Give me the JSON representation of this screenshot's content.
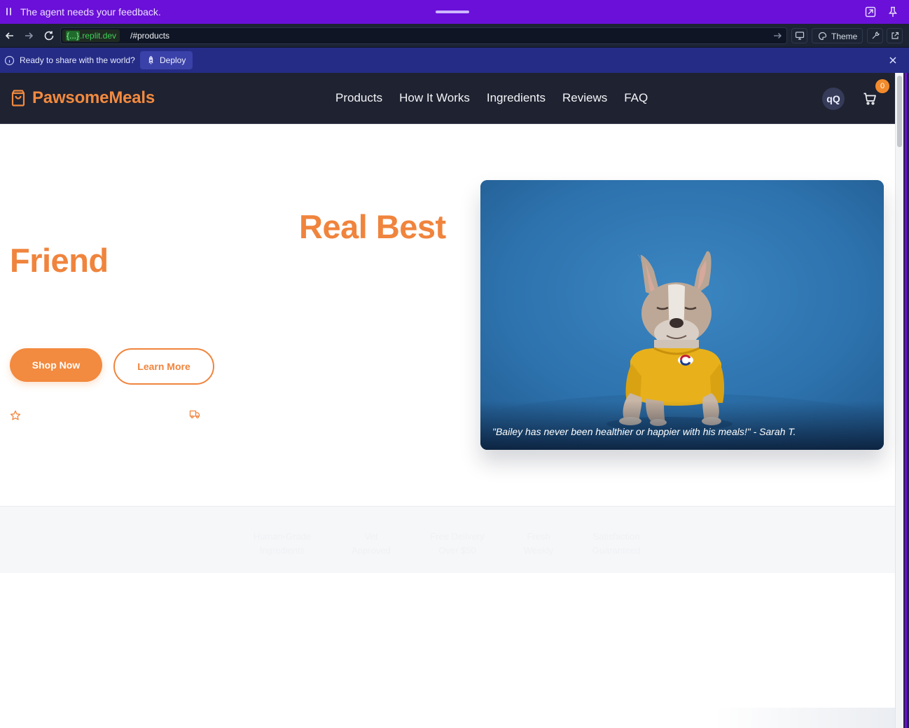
{
  "agent_bar": {
    "message": "The agent needs your feedback."
  },
  "url_bar": {
    "host_braces": "{...}",
    "host_domain": ".replit.dev",
    "path": "/#products",
    "theme_label": "Theme"
  },
  "deploy_bar": {
    "prompt": "Ready to share with the world?",
    "deploy_label": "Deploy"
  },
  "site": {
    "brand": "PawsomeMeals",
    "nav": [
      "Products",
      "How It Works",
      "Ingredients",
      "Reviews",
      "FAQ"
    ],
    "avatar_initials": "qQ",
    "cart_count": "0"
  },
  "hero": {
    "headline_line1": "Real Best",
    "headline_line2": "Friend",
    "shop_label": "Shop Now",
    "learn_label": "Learn More",
    "testimonial": "\"Bailey has never been healthier or happier with his meals!\" - Sarah T."
  },
  "features": [
    [
      "Human-Grade",
      "Ingredients"
    ],
    [
      "Vet",
      "Approved"
    ],
    [
      "Free Delivery",
      "Over $50"
    ],
    [
      "Fresh",
      "Weekly"
    ],
    [
      "Satisfaction",
      "Guaranteed"
    ]
  ],
  "colors": {
    "agent_bar": "#6a10d8",
    "brand_orange": "#f28a3f",
    "header_bg": "#1f2230",
    "deploy_bar": "#252c86"
  }
}
